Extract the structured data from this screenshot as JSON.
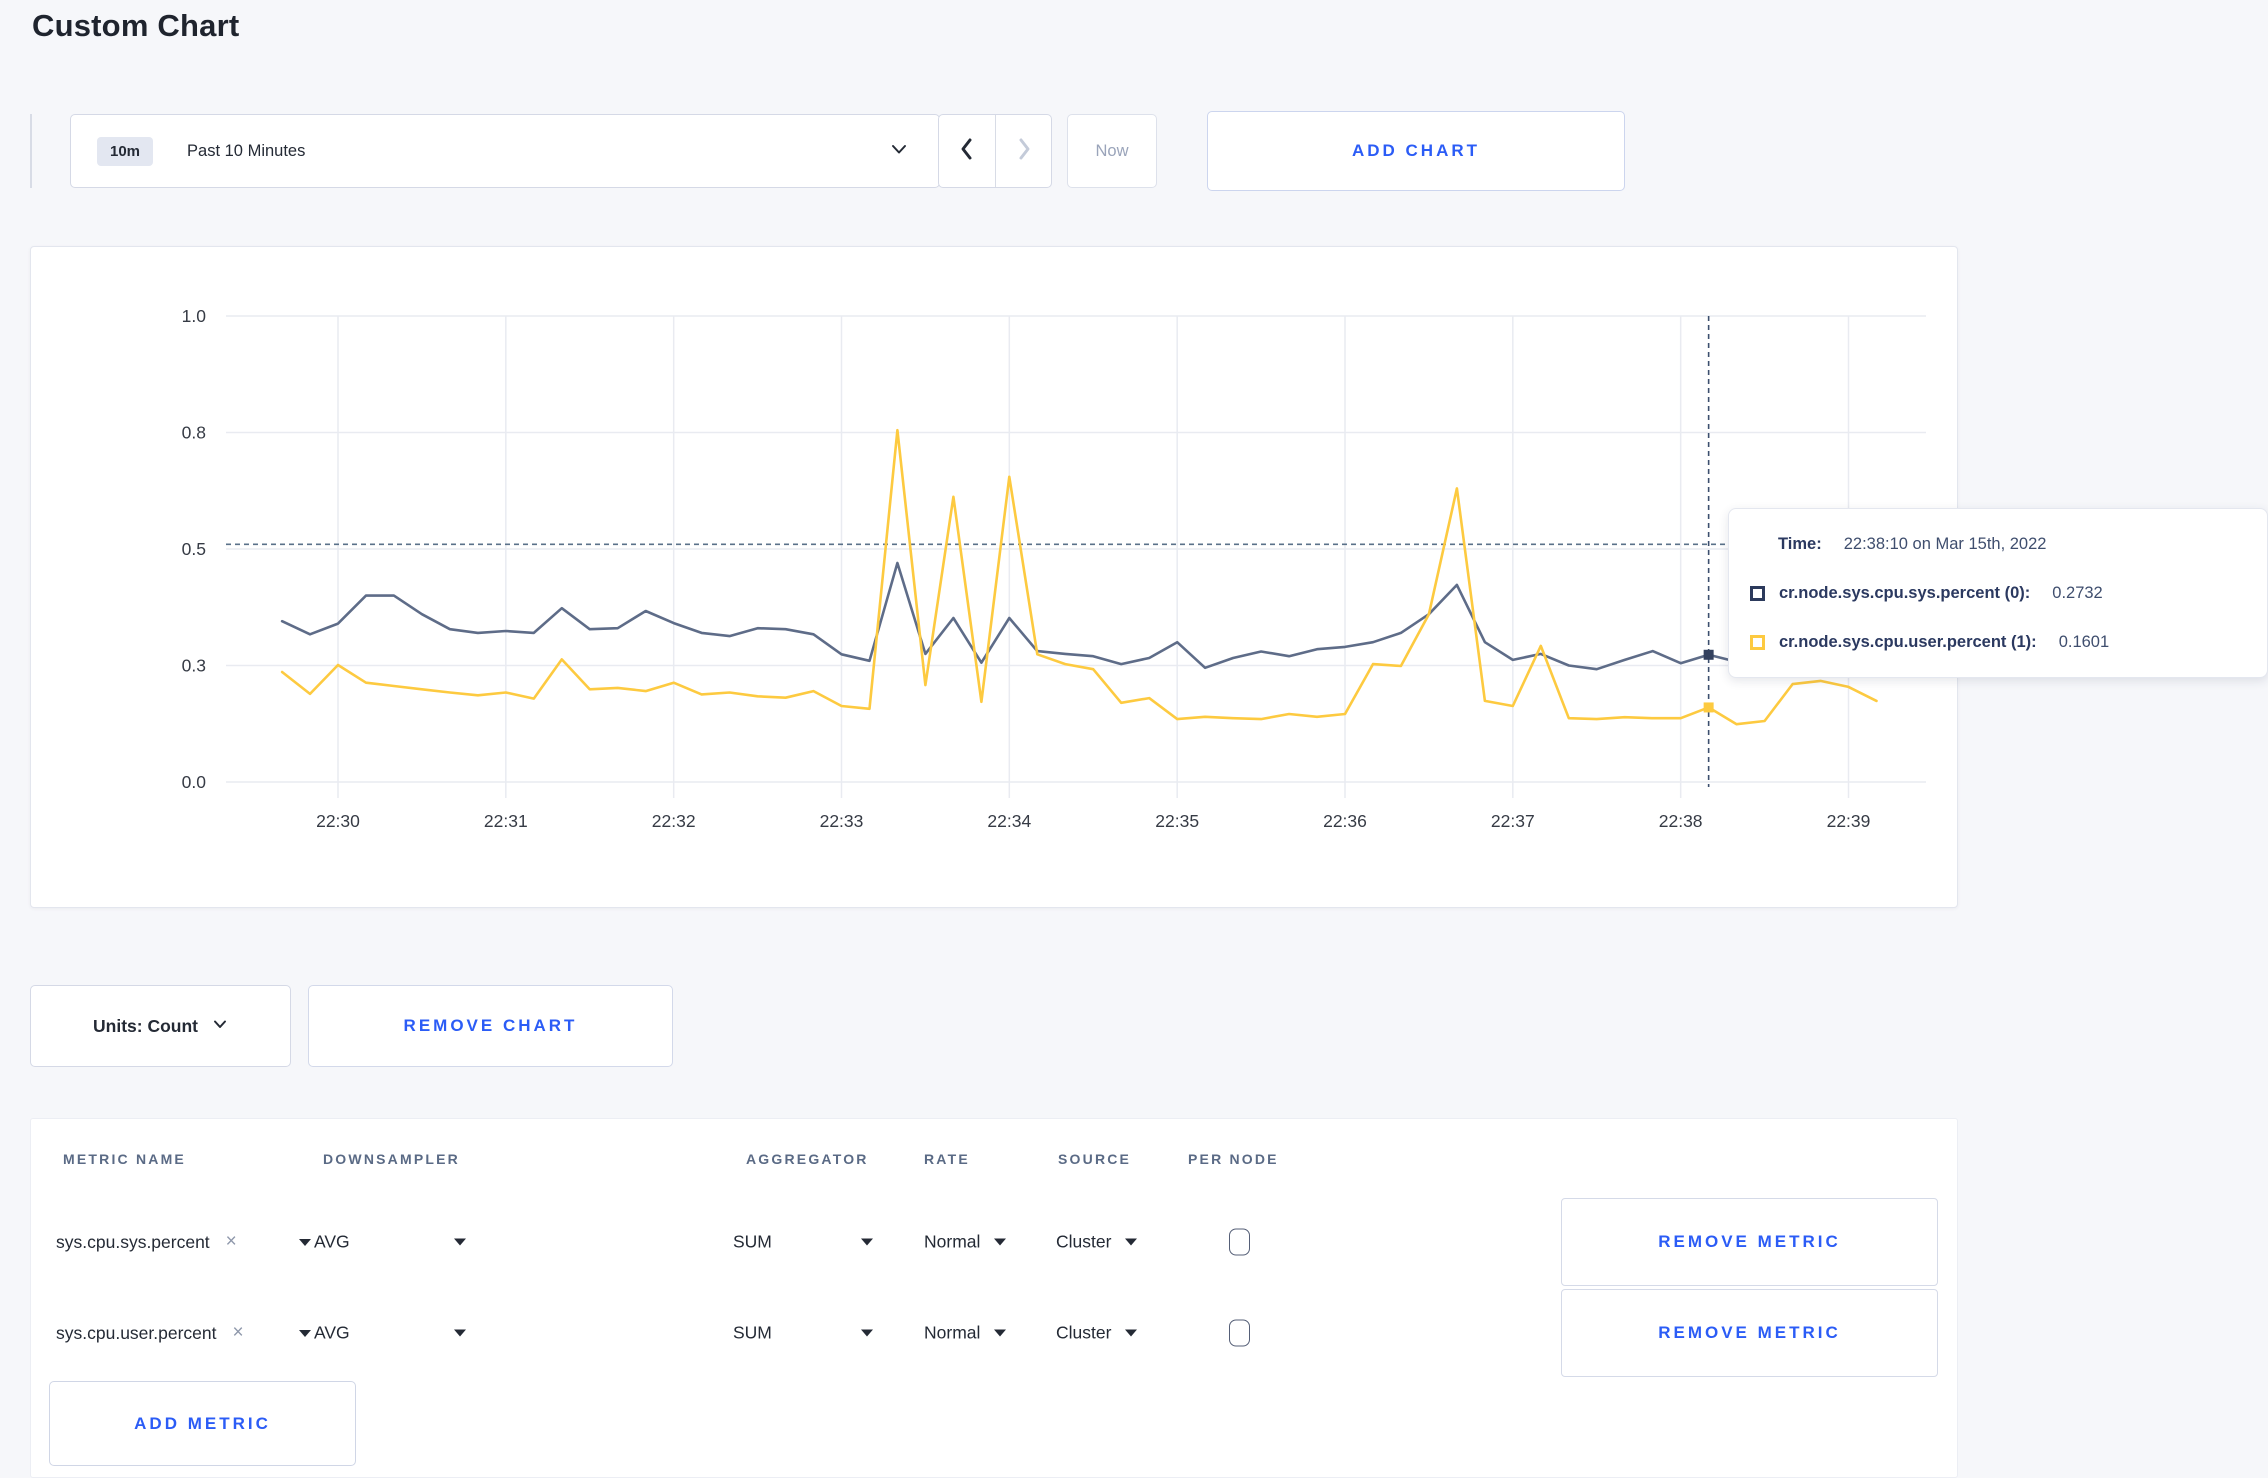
{
  "page": {
    "title": "Custom Chart"
  },
  "toolbar": {
    "time_badge": "10m",
    "time_label": "Past 10 Minutes",
    "prev_label": "previous time window",
    "next_label": "next time window",
    "now_label": "Now",
    "add_chart_label": "ADD CHART"
  },
  "chart": {
    "tooltip": {
      "time_label": "Time:",
      "time_value": "22:38:10 on Mar 15th, 2022",
      "series": [
        {
          "name": "cr.node.sys.cpu.sys.percent (0):",
          "value": "0.2732",
          "color": "#2c3a5c"
        },
        {
          "name": "cr.node.sys.cpu.user.percent (1):",
          "value": "0.1601",
          "color": "#fdca40"
        }
      ]
    }
  },
  "chart_data": {
    "type": "line",
    "title": "",
    "xlabel": "",
    "ylabel": "",
    "ylim": [
      0,
      1
    ],
    "grid": true,
    "x_tick_labels": [
      "22:30",
      "22:31",
      "22:32",
      "22:33",
      "22:34",
      "22:35",
      "22:36",
      "22:37",
      "22:38",
      "22:39"
    ],
    "y_ticks": [
      {
        "label": "0.0",
        "value": 0
      },
      {
        "label": "0.3",
        "value": 0.25
      },
      {
        "label": "0.5",
        "value": 0.5
      },
      {
        "label": "0.8",
        "value": 0.75
      },
      {
        "label": "1.0",
        "value": 1
      }
    ],
    "start_time": "22:29:40",
    "interval_seconds": 10,
    "threshold_value": 0.51,
    "crosshair": {
      "index": 51,
      "time": "22:38:10"
    },
    "series": [
      {
        "name": "cr.node.sys.cpu.sys.percent",
        "color": "#5e6c88",
        "values": [
          0.345,
          0.317,
          0.34,
          0.4,
          0.4,
          0.36,
          0.328,
          0.32,
          0.324,
          0.32,
          0.373,
          0.328,
          0.33,
          0.367,
          0.341,
          0.32,
          0.313,
          0.33,
          0.328,
          0.317,
          0.274,
          0.26,
          0.47,
          0.275,
          0.352,
          0.256,
          0.352,
          0.281,
          0.275,
          0.27,
          0.253,
          0.266,
          0.3,
          0.245,
          0.266,
          0.28,
          0.27,
          0.285,
          0.29,
          0.3,
          0.32,
          0.36,
          0.423,
          0.3,
          0.262,
          0.275,
          0.25,
          0.242,
          0.262,
          0.281,
          0.255,
          0.273,
          0.258,
          0.285,
          0.3,
          0.292,
          0.3,
          0.305
        ]
      },
      {
        "name": "cr.node.sys.cpu.user.percent",
        "color": "#fdca40",
        "values": [
          0.236,
          0.189,
          0.251,
          0.213,
          0.206,
          0.199,
          0.192,
          0.186,
          0.192,
          0.179,
          0.263,
          0.199,
          0.202,
          0.195,
          0.213,
          0.188,
          0.192,
          0.184,
          0.181,
          0.195,
          0.163,
          0.157,
          0.755,
          0.208,
          0.612,
          0.172,
          0.655,
          0.274,
          0.253,
          0.242,
          0.17,
          0.18,
          0.135,
          0.14,
          0.137,
          0.135,
          0.146,
          0.14,
          0.146,
          0.253,
          0.249,
          0.36,
          0.63,
          0.174,
          0.163,
          0.292,
          0.137,
          0.135,
          0.139,
          0.137,
          0.137,
          0.16,
          0.124,
          0.131,
          0.21,
          0.217,
          0.204,
          0.174
        ]
      }
    ]
  },
  "units_bar": {
    "units_label": "Units: Count",
    "remove_chart_label": "REMOVE CHART"
  },
  "metrics_table": {
    "headers": [
      "METRIC NAME",
      "DOWNSAMPLER",
      "AGGREGATOR",
      "RATE",
      "SOURCE",
      "PER NODE"
    ],
    "rows": [
      {
        "metric": "sys.cpu.sys.percent",
        "clear": "×",
        "downsampler": "AVG",
        "aggregator": "SUM",
        "rate": "Normal",
        "source": "Cluster",
        "per_node_checked": false,
        "remove_label": "REMOVE METRIC"
      },
      {
        "metric": "sys.cpu.user.percent",
        "clear": "×",
        "downsampler": "AVG",
        "aggregator": "SUM",
        "rate": "Normal",
        "source": "Cluster",
        "per_node_checked": false,
        "remove_label": "REMOVE METRIC"
      }
    ],
    "add_metric_label": "ADD METRIC"
  },
  "colors": {
    "accent_blue": "#2b5cf6",
    "series_sys": "#5e6c88",
    "series_user": "#fdca40",
    "grid": "#e9ebf1",
    "threshold_line": "#5a7189",
    "crosshair": "#3c4f6e",
    "page_background": "#f6f7fa"
  }
}
